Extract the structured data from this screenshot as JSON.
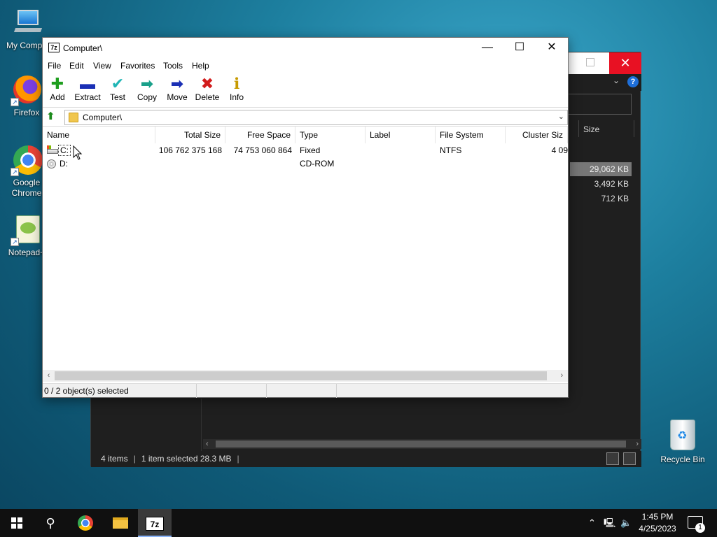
{
  "desktop": {
    "icons": [
      {
        "label": "My Compu"
      },
      {
        "label": "Firefox"
      },
      {
        "label": "Google Chrome"
      },
      {
        "label": "Notepad+"
      }
    ],
    "recycle_bin": "Recycle Bin"
  },
  "bg_explorer": {
    "close_glyph": "✕",
    "help_glyph": "?",
    "column_size": "Size",
    "sizes": [
      "29,062 KB",
      "3,492 KB",
      "712 KB"
    ],
    "status": {
      "items": "4 items",
      "selected": "1 item selected  28.3 MB"
    }
  },
  "window": {
    "icon_text": "7z",
    "title": "Computer\\",
    "minimize": "—",
    "maximize": "☐",
    "close": "✕",
    "menu": [
      "File",
      "Edit",
      "View",
      "Favorites",
      "Tools",
      "Help"
    ],
    "toolbar": [
      {
        "label": "Add",
        "glyph": "✚",
        "color": "#1e9e1e"
      },
      {
        "label": "Extract",
        "glyph": "▬",
        "color": "#1a2fb5"
      },
      {
        "label": "Test",
        "glyph": "✔",
        "color": "#1fb5b5"
      },
      {
        "label": "Copy",
        "glyph": "➡",
        "color": "#1aa08a"
      },
      {
        "label": "Move",
        "glyph": "➡",
        "color": "#1a2fb5"
      },
      {
        "label": "Delete",
        "glyph": "✖",
        "color": "#d21c1c"
      },
      {
        "label": "Info",
        "glyph": "ℹ",
        "color": "#c79a00"
      }
    ],
    "address": "Computer\\",
    "columns": [
      "Name",
      "Total Size",
      "Free Space",
      "Type",
      "Label",
      "File System",
      "Cluster Siz"
    ],
    "rows": [
      {
        "name": "C:",
        "total": "106 762 375 168",
        "free": "74 753 060 864",
        "type": "Fixed",
        "label": "",
        "fs": "NTFS",
        "cluster": "4 09"
      },
      {
        "name": "D:",
        "total": "",
        "free": "",
        "type": "CD-ROM",
        "label": "",
        "fs": "",
        "cluster": ""
      }
    ],
    "status": "0 / 2 object(s) selected"
  },
  "taskbar": {
    "time": "1:45 PM",
    "date": "4/25/2023",
    "notification_count": "1",
    "zip_label": "7z"
  },
  "colors": {
    "accent": "#0078d7",
    "close_red": "#e81123"
  }
}
